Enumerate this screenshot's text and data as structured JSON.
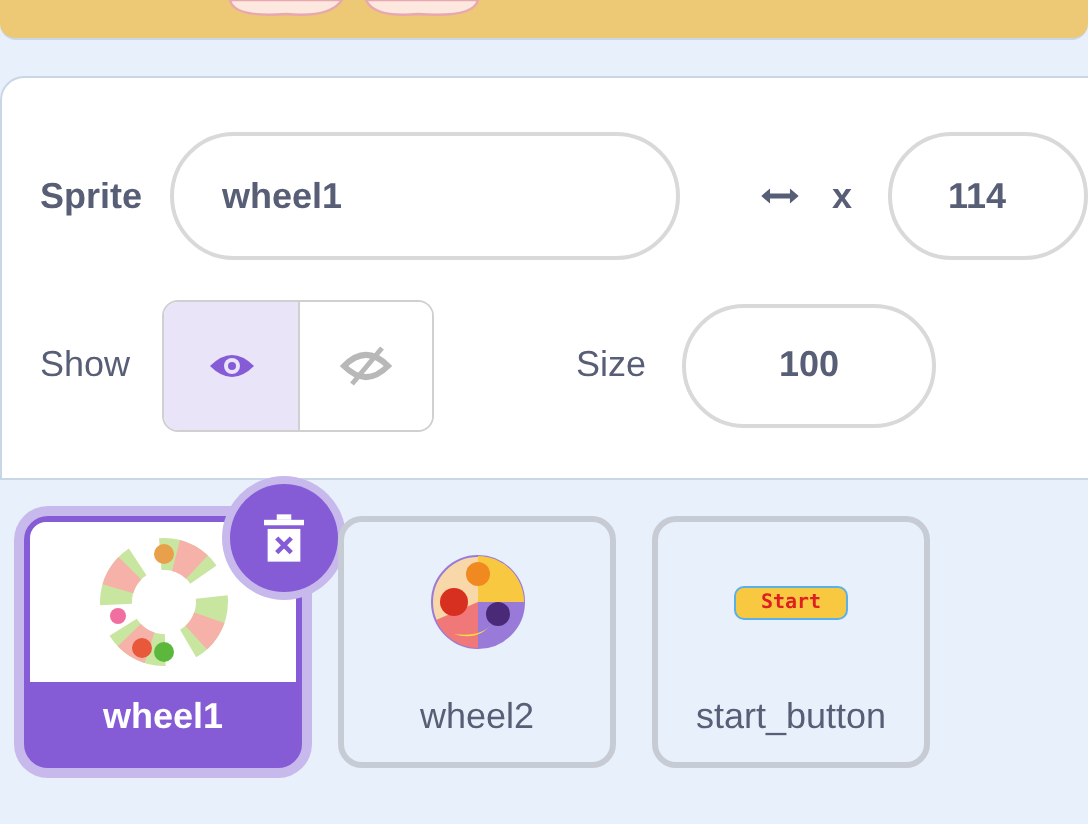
{
  "sprite_info": {
    "sprite_label": "Sprite",
    "sprite_name": "wheel1",
    "x_label": "x",
    "x_value": "114",
    "show_label": "Show",
    "show_options": [
      {
        "kind": "visible",
        "selected": true
      },
      {
        "kind": "hidden",
        "selected": false
      }
    ],
    "size_label": "Size",
    "size_value": "100"
  },
  "sprites": [
    {
      "name": "wheel1",
      "kind": "ring",
      "selected": true
    },
    {
      "name": "wheel2",
      "kind": "fruit",
      "selected": false
    },
    {
      "name": "start_button",
      "kind": "button",
      "thumbnail_text": "Start",
      "selected": false
    }
  ]
}
